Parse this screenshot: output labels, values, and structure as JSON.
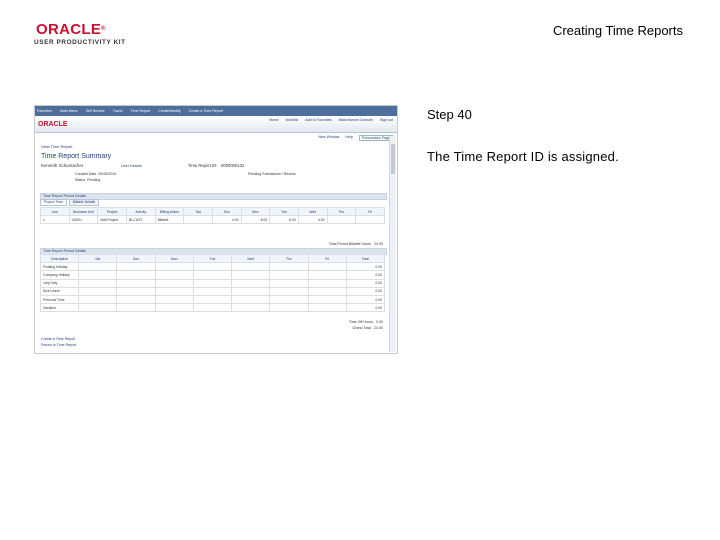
{
  "logo": {
    "brand": "ORACLE",
    "product": "USER PRODUCTIVITY KIT"
  },
  "doc_title": "Creating Time Reports",
  "step": "Step 40",
  "instruction": "The Time Report ID is assigned.",
  "screenshot": {
    "topbar_items": [
      "Favorites",
      "Main Menu",
      "Self Service",
      "Travel",
      "Time Report",
      "Create/Modify",
      "Create a Time Report"
    ],
    "brand": "ORACLE",
    "header_links": [
      "Home",
      "Worklist",
      "Add to Favorites",
      "Multichannel Console",
      "Sign out"
    ],
    "nav_links": [
      "New Window",
      "Help",
      "Personalize Page"
    ],
    "page_link": "View Time Report",
    "page_title": "Time Report Summary",
    "employee": "Kenneth Schumacher",
    "user_details": "User Details",
    "report_id_label": "Time Report ID",
    "report_id_value": "0000000132",
    "created_label": "Created Date",
    "created_value": "09/26/2010",
    "status_label": "Status",
    "status_value": "Pending",
    "sub_status": "Pending Submission / Review",
    "section1_title": "Time Report Period Details",
    "tab1": "Project Time",
    "tab2": "Billable Details",
    "grid1_headers": [
      "Line",
      "Business Unit",
      "Project",
      "Activity",
      "Billing Action",
      "Sat",
      "Sun",
      "Mon",
      "Tue",
      "Wed",
      "Thu",
      "Fri"
    ],
    "grid1_row": [
      "1",
      "US001",
      "Mall Project",
      "BI-CUST",
      "Billable",
      "",
      "4.00",
      "8.00",
      "8.00",
      "4.00",
      "",
      ""
    ],
    "total_project_hours_label": "Total Period Billable Hours",
    "total_project_hours_value": "24.00",
    "section2_title": "Time Report Period Details",
    "grid2_headers": [
      "Description",
      "Sat",
      "Sun",
      "Mon",
      "Tue",
      "Wed",
      "Thu",
      "Fri",
      "Total"
    ],
    "grid2_rows": [
      [
        "Floating Holiday",
        "",
        "",
        "",
        "",
        "",
        "",
        "",
        "0.00"
      ],
      [
        "Company Holiday",
        "",
        "",
        "",
        "",
        "",
        "",
        "",
        "0.00"
      ],
      [
        "Jury Duty",
        "",
        "",
        "",
        "",
        "",
        "",
        "",
        "0.00"
      ],
      [
        "Sick Leave",
        "",
        "",
        "",
        "",
        "",
        "",
        "",
        "0.00"
      ],
      [
        "Personal Time",
        "",
        "",
        "",
        "",
        "",
        "",
        "",
        "0.00"
      ],
      [
        "Vacation",
        "",
        "",
        "",
        "",
        "",
        "",
        "",
        "0.00"
      ]
    ],
    "time_off_label": "Time Off Hours",
    "time_off_value": "0.00",
    "grand_total_label": "Grand Total",
    "grand_total_value": "24.00",
    "footer_links": [
      "Create a Time Report",
      "Return to Time Report"
    ]
  }
}
